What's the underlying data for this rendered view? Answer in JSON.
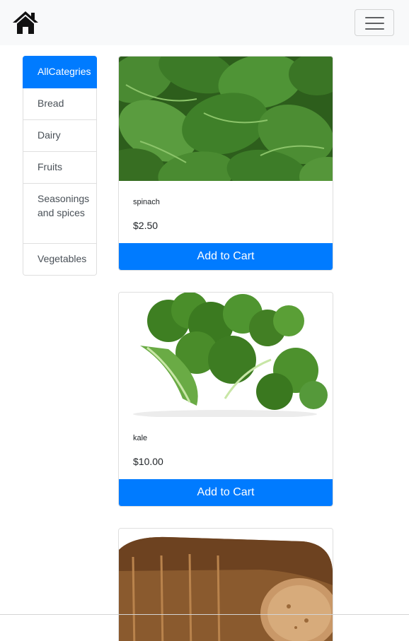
{
  "nav": {
    "home_icon": "home-icon",
    "menu_icon": "hamburger-menu-icon"
  },
  "categories": [
    {
      "label": "AllCategries",
      "active": true
    },
    {
      "label": "Bread",
      "active": false
    },
    {
      "label": "Dairy",
      "active": false
    },
    {
      "label": "Fruits",
      "active": false
    },
    {
      "label": "Seasonings and spices",
      "active": false
    },
    {
      "label": "Vegetables",
      "active": false
    }
  ],
  "products": [
    {
      "name": "spinach",
      "price": "$2.50",
      "button_label": "Add to Cart"
    },
    {
      "name": "kale",
      "price": "$10.00",
      "button_label": "Add to Cart"
    }
  ],
  "colors": {
    "primary": "#007bff",
    "navbar_bg": "#f8f9fa",
    "spinach_green": "#3f7d2a",
    "kale_green": "#4e8b2b",
    "bread_brown": "#9c6a3a"
  }
}
